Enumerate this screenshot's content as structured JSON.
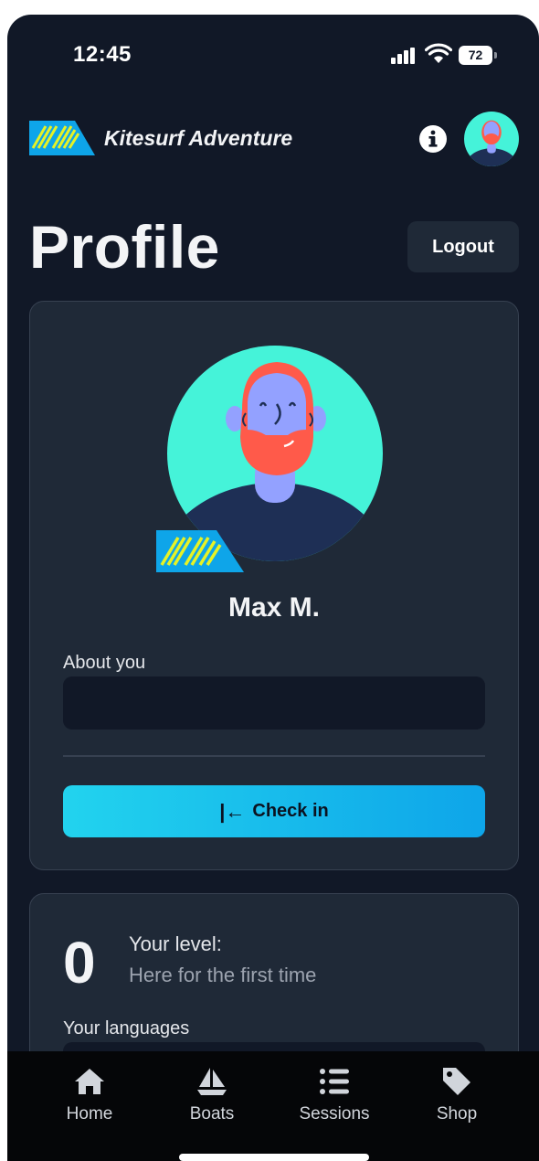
{
  "status_bar": {
    "time": "12:45",
    "battery": "72"
  },
  "header": {
    "brand_name": "Kitesurf Adventure"
  },
  "page": {
    "title": "Profile",
    "logout_label": "Logout"
  },
  "profile": {
    "user_name": "Max M.",
    "about_label": "About you",
    "about_value": "",
    "checkin_label": "Check in"
  },
  "level": {
    "number": "0",
    "label": "Your level:",
    "value": "Here for the first time",
    "languages_label": "Your languages"
  },
  "nav": {
    "items": [
      {
        "label": "Home",
        "icon": "home-icon"
      },
      {
        "label": "Boats",
        "icon": "sailboat-icon"
      },
      {
        "label": "Sessions",
        "icon": "list-icon"
      },
      {
        "label": "Shop",
        "icon": "tag-icon"
      }
    ]
  },
  "colors": {
    "background": "#111827",
    "card": "#1f2937",
    "accent": "#22d3ee",
    "avatar_bg": "#45f3d9",
    "brand_yellow": "#e6f226",
    "brand_blue": "#0ea5e9"
  }
}
